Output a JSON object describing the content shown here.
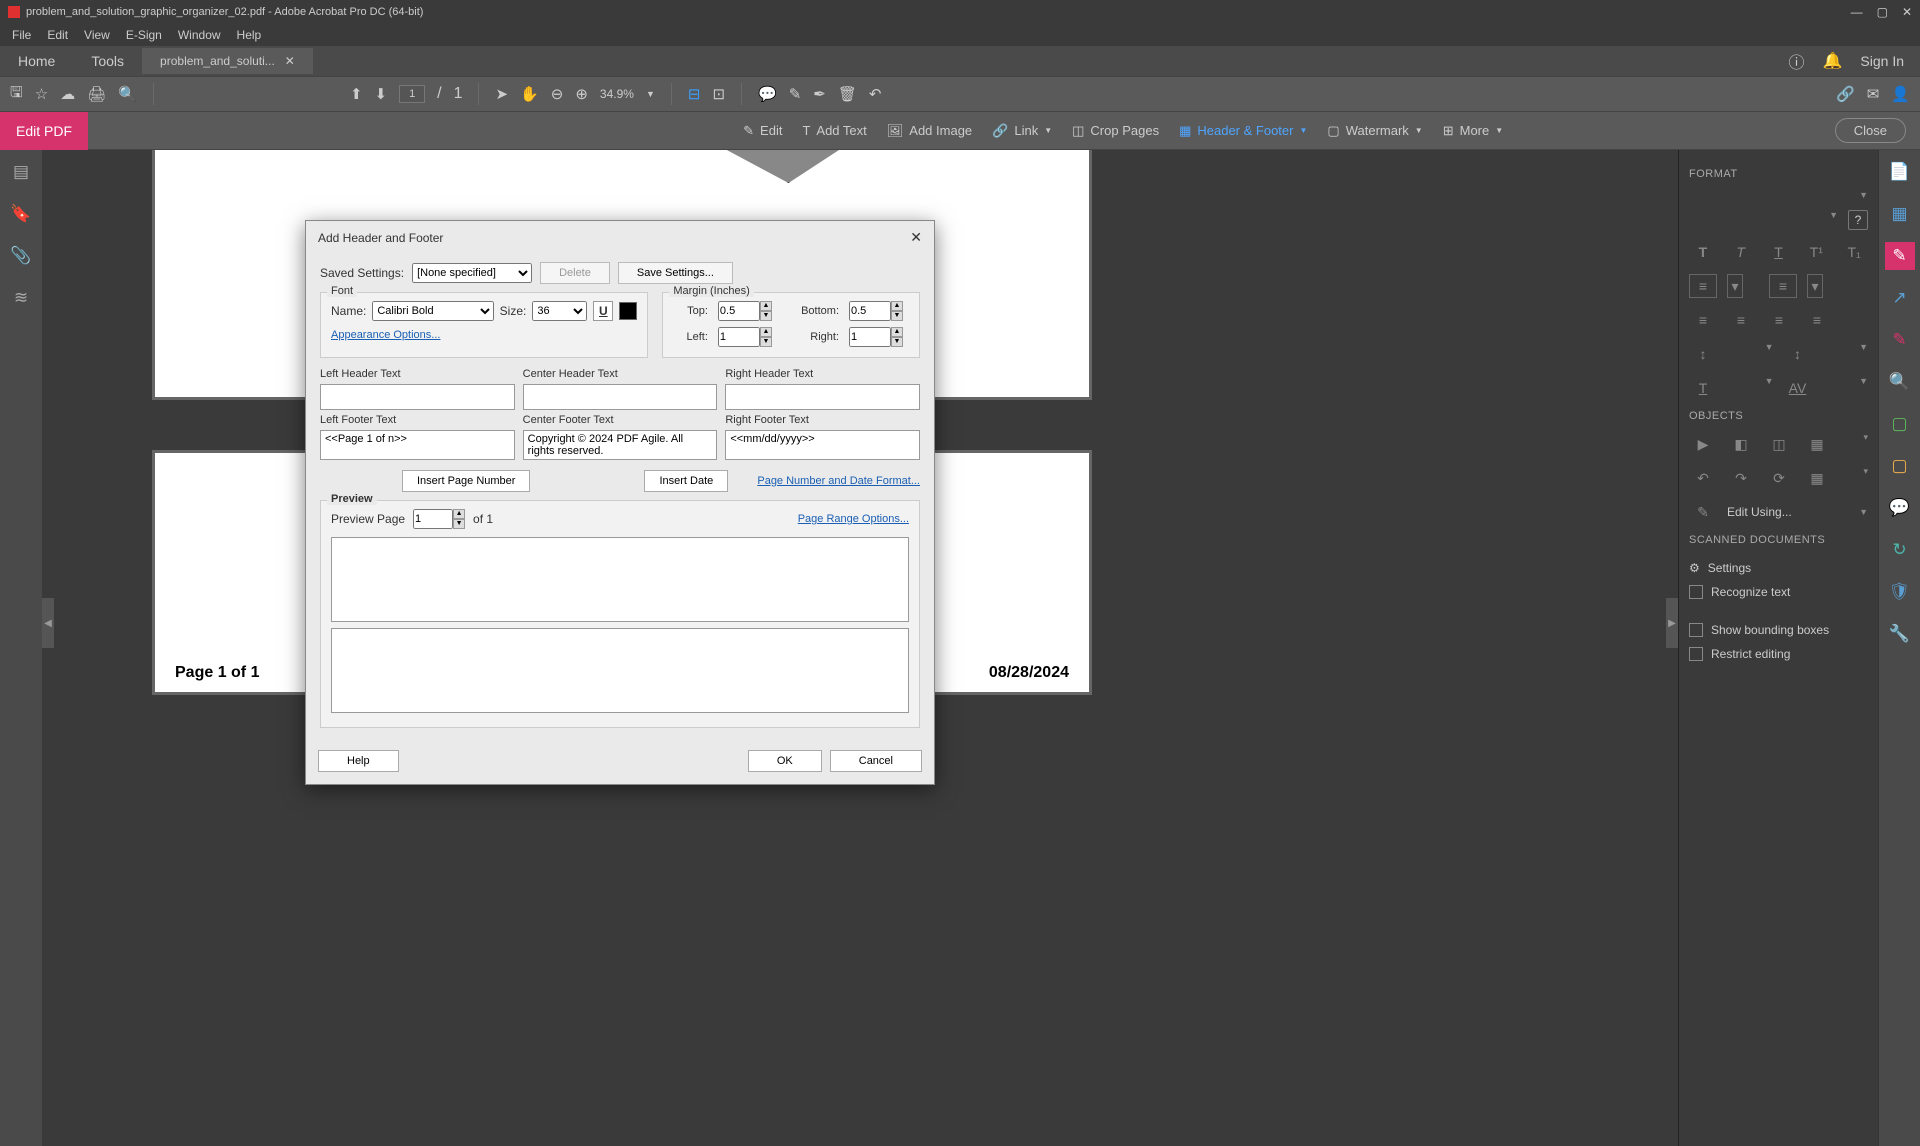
{
  "titlebar": {
    "text": "problem_and_solution_graphic_organizer_02.pdf - Adobe Acrobat Pro DC (64-bit)"
  },
  "menubar": [
    "File",
    "Edit",
    "View",
    "E-Sign",
    "Window",
    "Help"
  ],
  "tabs": {
    "home": "Home",
    "tools": "Tools",
    "doc": "problem_and_soluti...",
    "sign_in": "Sign In"
  },
  "toolbar": {
    "page_current": "1",
    "page_sep": "/",
    "page_total": "1",
    "zoom": "34.9%"
  },
  "edit_toolbar": {
    "label": "Edit PDF",
    "edit": "Edit",
    "add_text": "Add Text",
    "add_image": "Add Image",
    "link": "Link",
    "crop": "Crop Pages",
    "header_footer": "Header & Footer",
    "watermark": "Watermark",
    "more": "More",
    "close": "Close"
  },
  "dialog": {
    "title": "Add Header and Footer",
    "saved_settings_label": "Saved Settings:",
    "saved_settings_value": "[None specified]",
    "delete": "Delete",
    "save_settings": "Save Settings...",
    "font_legend": "Font",
    "name_label": "Name:",
    "font_name": "Calibri Bold",
    "size_label": "Size:",
    "font_size": "36",
    "appearance_link": "Appearance Options...",
    "margin_legend": "Margin (Inches)",
    "top_label": "Top:",
    "top_val": "0.5",
    "bottom_label": "Bottom:",
    "bottom_val": "0.5",
    "left_label": "Left:",
    "left_val": "1",
    "right_label": "Right:",
    "right_val": "1",
    "left_header": "Left Header Text",
    "center_header": "Center Header Text",
    "right_header": "Right Header Text",
    "left_footer": "Left Footer Text",
    "center_footer": "Center Footer Text",
    "right_footer": "Right Footer Text",
    "left_footer_val": "<<Page 1 of n>>",
    "center_footer_val": "Copyright © 2024 PDF Agile. All rights reserved.",
    "right_footer_val": "<<mm/dd/yyyy>>",
    "insert_page_number": "Insert Page Number",
    "insert_date": "Insert Date",
    "page_number_format": "Page Number and Date Format...",
    "preview_legend": "Preview",
    "preview_page_label": "Preview Page",
    "preview_page_val": "1",
    "preview_total": "of 1",
    "page_range_options": "Page Range Options...",
    "help": "Help",
    "ok": "OK",
    "cancel": "Cancel"
  },
  "right_panel": {
    "format": "FORMAT",
    "objects": "OBJECTS",
    "edit_using": "Edit Using...",
    "scanned": "SCANNED DOCUMENTS",
    "settings": "Settings",
    "recognize": "Recognize text",
    "show_bounding": "Show bounding boxes",
    "restrict": "Restrict editing"
  },
  "preview_footer": {
    "left": "Page 1 of 1",
    "center": "Copyright © 2024 PDF Agile. All rights reserved.",
    "right": "08/28/2024"
  }
}
